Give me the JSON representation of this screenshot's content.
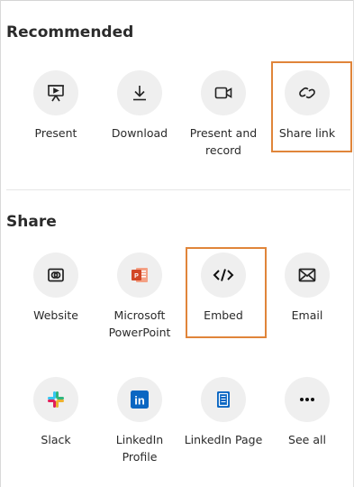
{
  "sections": {
    "recommended": {
      "title": "Recommended",
      "items": [
        {
          "label": "Present",
          "icon": "present-icon"
        },
        {
          "label": "Download",
          "icon": "download-icon"
        },
        {
          "label": "Present and record",
          "icon": "camera-icon"
        },
        {
          "label": "Share link",
          "icon": "link-icon"
        }
      ]
    },
    "share": {
      "title": "Share",
      "items": [
        {
          "label": "Website",
          "icon": "website-icon"
        },
        {
          "label": "Microsoft PowerPoint",
          "icon": "powerpoint-icon"
        },
        {
          "label": "Embed",
          "icon": "code-icon"
        },
        {
          "label": "Email",
          "icon": "mail-icon"
        },
        {
          "label": "Slack",
          "icon": "slack-icon"
        },
        {
          "label": "LinkedIn Profile",
          "icon": "linkedin-icon"
        },
        {
          "label": "LinkedIn Page",
          "icon": "linkedin-page-icon"
        },
        {
          "label": "See all",
          "icon": "more-icon"
        }
      ]
    }
  },
  "colors": {
    "highlight": "#e0853a",
    "powerpoint": "#d24726",
    "linkedin": "#0a66c2"
  }
}
